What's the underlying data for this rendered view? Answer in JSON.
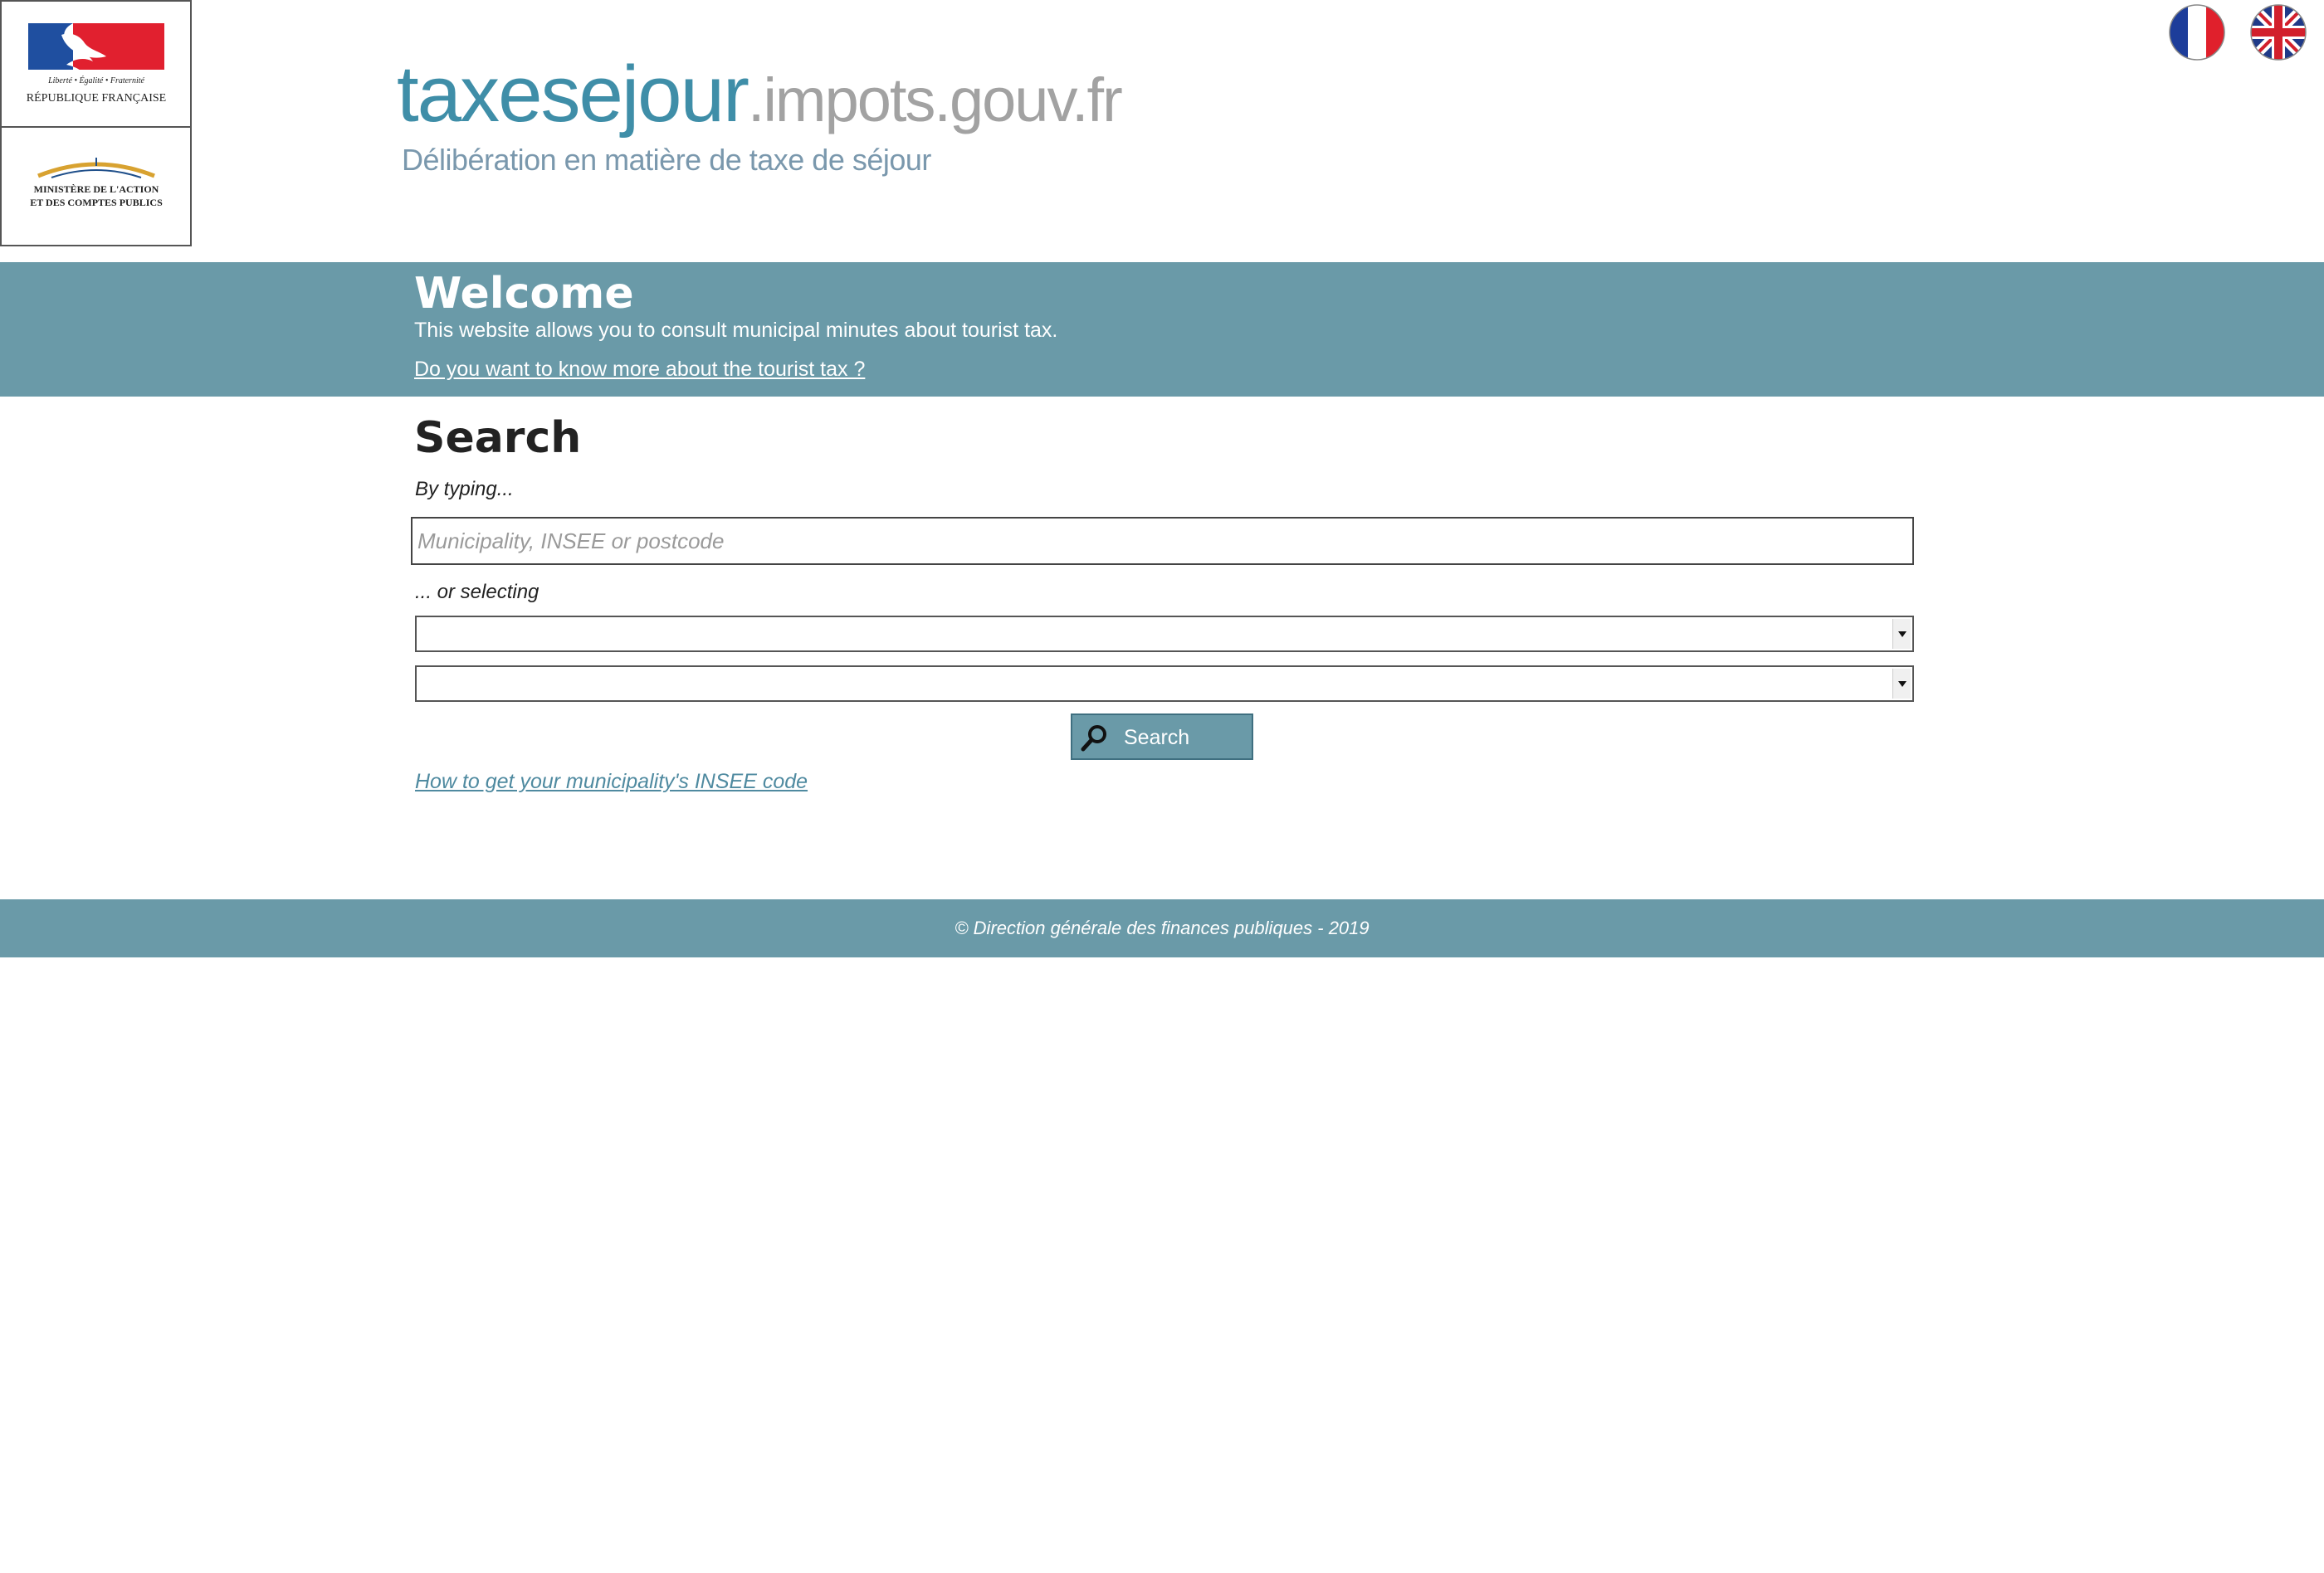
{
  "header": {
    "rf_logo": {
      "motto": "Liberté • Égalité • Fraternité",
      "name": "RÉPUBLIQUE FRANÇAISE"
    },
    "ministry_logo": {
      "line1": "MINISTÈRE DE L'ACTION",
      "line2": "ET DES COMPTES PUBLICS"
    },
    "site_logo": {
      "main": "taxesejour",
      "domain": ".impots.gouv.fr",
      "subtitle": "Délibération en matière de taxe de séjour"
    },
    "languages": [
      {
        "code": "fr",
        "icon": "french-flag-icon"
      },
      {
        "code": "en",
        "icon": "uk-flag-icon"
      }
    ]
  },
  "welcome": {
    "title": "Welcome",
    "text": "This website allows you to consult municipal minutes about tourist tax.",
    "link": "Do you want to know more about the tourist tax ?"
  },
  "search": {
    "title": "Search",
    "typing_label": "By typing...",
    "input_placeholder": "Municipality, INSEE or postcode",
    "input_value": "",
    "select_label": "... or selecting",
    "select_department_value": "",
    "select_municipality_value": "",
    "button_label": "Search",
    "button_icon": "magnifier-icon",
    "insee_link": "How to get your municipality's INSEE code"
  },
  "footer": {
    "text": "© Direction générale des finances publiques - 2019"
  },
  "colors": {
    "band": "#6a9aa8",
    "logo_blue": "#3f8ea8",
    "logo_grey": "#a2a2a2",
    "link": "#4f8aa0"
  }
}
